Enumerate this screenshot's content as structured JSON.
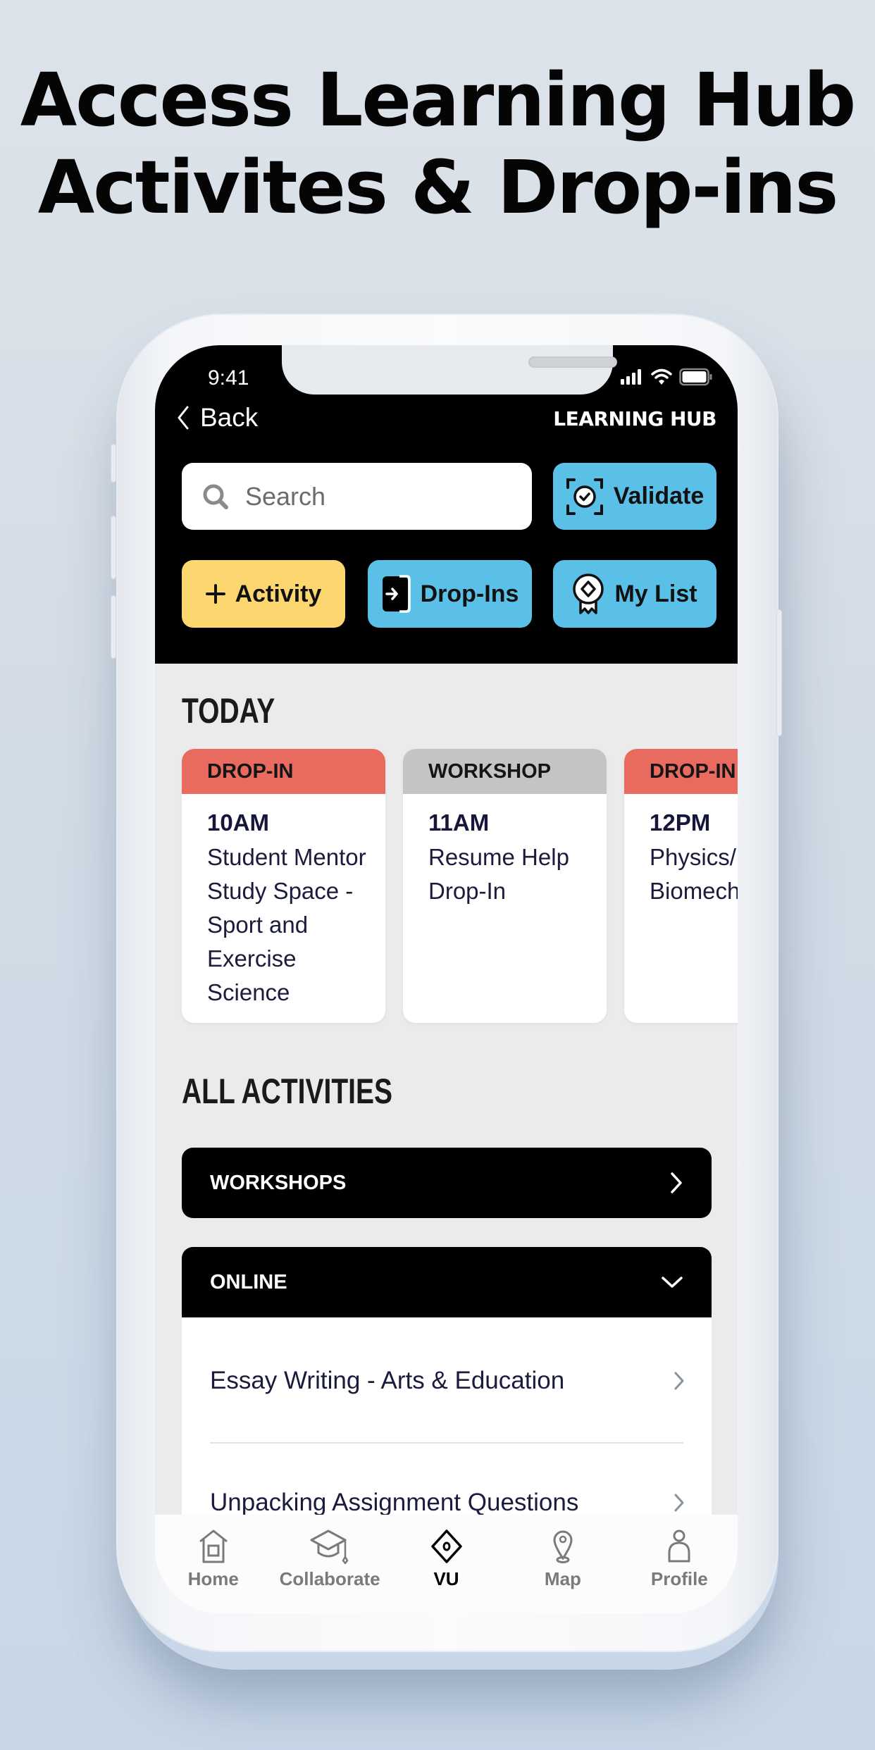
{
  "headline": {
    "line1": "Access Learning Hub",
    "line2": "Activites & Drop-ins"
  },
  "status_bar": {
    "time": "9:41",
    "icons": [
      "signal-icon",
      "wifi-icon",
      "battery-icon"
    ]
  },
  "header": {
    "back_label": "Back",
    "brand": "LEARNING HUB",
    "search_placeholder": "Search",
    "buttons": {
      "validate": "Validate",
      "activity": "Activity",
      "drop_ins": "Drop-Ins",
      "my_list": "My List"
    }
  },
  "today": {
    "title": "TODAY",
    "cards": [
      {
        "type": "DROP-IN",
        "time": "10AM",
        "title": "Student Mentor Study Space - Sport and Exercise Science",
        "color": "#e96a5e"
      },
      {
        "type": "WORKSHOP",
        "time": "11AM",
        "title": "Resume Help Drop-In",
        "color": "#c4c4c4"
      },
      {
        "type": "DROP-IN",
        "time": "12PM",
        "title": "Physics/ Biomech",
        "color": "#e96a5e"
      }
    ]
  },
  "all_activities": {
    "title": "ALL ACTIVITIES",
    "categories": [
      {
        "label": "WORKSHOPS",
        "state": "collapsed"
      },
      {
        "label": "ONLINE",
        "state": "expanded"
      }
    ],
    "online_items": [
      "Essay Writing - Arts & Education",
      "Unpacking Assignment Questions"
    ]
  },
  "tabbar": {
    "items": [
      {
        "label": "Home",
        "icon": "home-icon"
      },
      {
        "label": "Collaborate",
        "icon": "graduation-cap-icon"
      },
      {
        "label": "VU",
        "icon": "vu-diamond-icon",
        "active": true
      },
      {
        "label": "Map",
        "icon": "map-pin-icon"
      },
      {
        "label": "Profile",
        "icon": "person-icon"
      }
    ]
  },
  "colors": {
    "accent_blue": "#5bc0e8",
    "accent_yellow": "#fcd770",
    "drop_in_red": "#e96a5e",
    "workshop_grey": "#c4c4c4",
    "header_black": "#000000"
  }
}
